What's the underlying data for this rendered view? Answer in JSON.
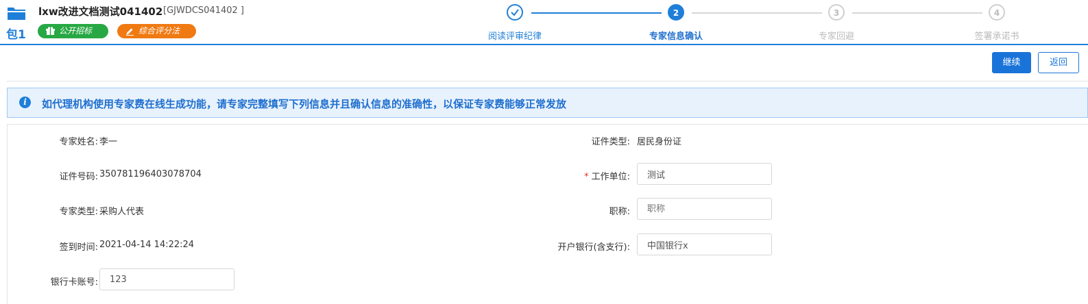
{
  "header": {
    "package_label": "包1",
    "project_title": "lxw改进文档测试041402",
    "project_code": "[GJWDCS041402 ]",
    "tags": [
      {
        "label": "公开招标",
        "icon": "gift-icon",
        "color": "#27a844"
      },
      {
        "label": "综合评分法",
        "icon": "pencil-icon",
        "color": "#f07a12"
      }
    ]
  },
  "steps": [
    {
      "number": "✓",
      "label": "阅读评审纪律",
      "state": "done"
    },
    {
      "number": "2",
      "label": "专家信息确认",
      "state": "active"
    },
    {
      "number": "3",
      "label": "专家回避",
      "state": "pending"
    },
    {
      "number": "4",
      "label": "签署承诺书",
      "state": "pending"
    }
  ],
  "actions": {
    "continue_label": "继续",
    "back_label": "返回"
  },
  "notice": {
    "icon": "info-icon",
    "text": "如代理机构使用专家费在线生成功能，请专家完整填写下列信息并且确认信息的准确性，以保证专家费能够正常发放"
  },
  "form": {
    "expert_name": {
      "label": "专家姓名:",
      "value": "李一"
    },
    "id_type": {
      "label": "证件类型:",
      "value": "居民身份证"
    },
    "id_number": {
      "label": "证件号码:",
      "value": "350781196403078704"
    },
    "work_unit": {
      "required_mark": "*",
      "label": "工作单位:",
      "value": "测试"
    },
    "expert_type": {
      "label": "专家类型:",
      "value": "采购人代表"
    },
    "title": {
      "label": "职称:",
      "placeholder": "职称"
    },
    "checkin_time": {
      "label": "签到时间:",
      "value": "2021-04-14 14:22:24"
    },
    "bank": {
      "label": "开户银行(含支行):",
      "value": "中国银行x"
    },
    "card_number": {
      "label": "银行卡账号:",
      "value": "123"
    }
  },
  "colors": {
    "primary": "#1f7fd8",
    "pending": "#cccccc",
    "green_tag": "#27a844",
    "orange_tag": "#f07a12"
  }
}
